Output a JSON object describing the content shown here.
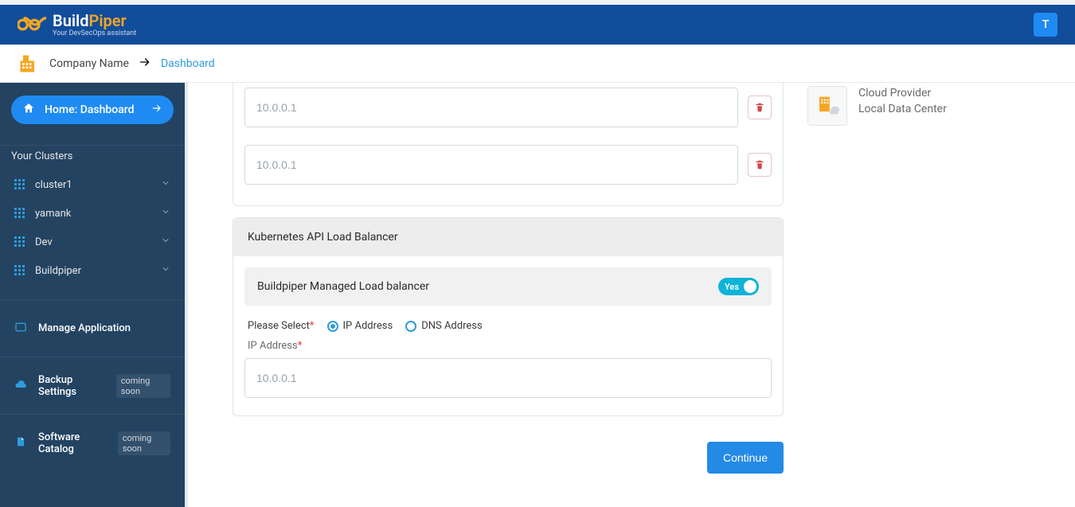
{
  "brand": {
    "primary": "Build",
    "accent": "Piper",
    "sub": "Your DevSecOps assistant"
  },
  "user_initial": "T",
  "breadcrumb": {
    "company": "Company Name",
    "current": "Dashboard"
  },
  "sidebar": {
    "home": "Home: Dashboard",
    "section_clusters": "Your Clusters",
    "clusters": [
      "cluster1",
      "yamank",
      "Dev",
      "Buildpiper"
    ],
    "nav": [
      {
        "label": "Manage Application",
        "soon": false
      },
      {
        "label": "Backup Settings",
        "soon": true
      },
      {
        "label": "Software Catalog",
        "soon": true
      }
    ],
    "soon_text": "coming soon"
  },
  "form": {
    "ip_placeholder": "10.0.0.1",
    "lb_section_title": "Kubernetes API Load Balancer",
    "lb_managed_label": "Buildpiper Managed Load balancer",
    "lb_managed_toggle": "Yes",
    "select_label": "Please Select",
    "radio_ip": "IP Address",
    "radio_dns": "DNS Address",
    "ip_field_label": "IP Address",
    "continue": "Continue"
  },
  "info": {
    "line1": "Cloud Provider",
    "line2": "Local Data Center"
  }
}
